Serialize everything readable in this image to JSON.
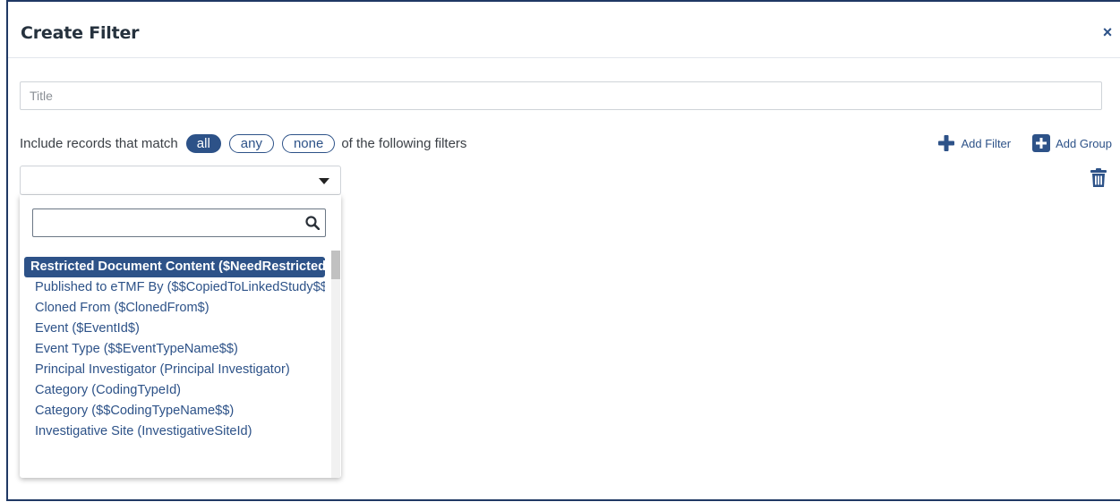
{
  "dialog": {
    "title": "Create Filter",
    "close_icon": "×"
  },
  "title_field": {
    "placeholder": "Title",
    "value": ""
  },
  "match": {
    "prefix": "Include records that match",
    "options": [
      "all",
      "any",
      "none"
    ],
    "selected": "all",
    "suffix": "of the following filters"
  },
  "actions": {
    "add_filter": "Add Filter",
    "add_group": "Add Group"
  },
  "field_select": {
    "value": "",
    "search_placeholder": "",
    "options": [
      "Restricted Document Content ($NeedRestrictedAccess$)",
      "Published to eTMF By ($$CopiedToLinkedStudy$$)",
      "Cloned From ($ClonedFrom$)",
      "Event ($EventId$)",
      "Event Type ($$EventTypeName$$)",
      "Principal Investigator (Principal Investigator)",
      "Category (CodingTypeId)",
      "Category ($$CodingTypeName$$)",
      "Investigative Site (InvestigativeSiteId)"
    ],
    "selected_index": 0
  },
  "colors": {
    "accent": "#2d5288",
    "border": "#1f3864"
  }
}
